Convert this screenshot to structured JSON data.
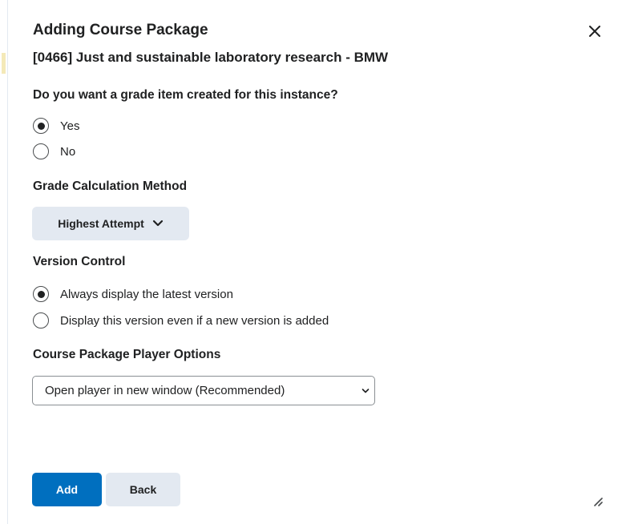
{
  "dialog": {
    "title": "Adding Course Package",
    "subtitle": "[0466] Just and sustainable laboratory research - BMW",
    "close_icon": "close-icon"
  },
  "grade_item": {
    "question": "Do you want a grade item created for this instance?",
    "options": [
      {
        "label": "Yes",
        "checked": true
      },
      {
        "label": "No",
        "checked": false
      }
    ]
  },
  "grade_calculation": {
    "label": "Grade Calculation Method",
    "selected": "Highest Attempt"
  },
  "version_control": {
    "label": "Version Control",
    "options": [
      {
        "label": "Always display the latest version",
        "checked": true
      },
      {
        "label": "Display this version even if a new version is added",
        "checked": false
      }
    ]
  },
  "player_options": {
    "label": "Course Package Player Options",
    "selected": "Open player in new window (Recommended)"
  },
  "actions": {
    "add_label": "Add",
    "back_label": "Back"
  },
  "colors": {
    "primary": "#006fbf",
    "secondary_bg": "#e3e9f1",
    "text": "#202122"
  }
}
